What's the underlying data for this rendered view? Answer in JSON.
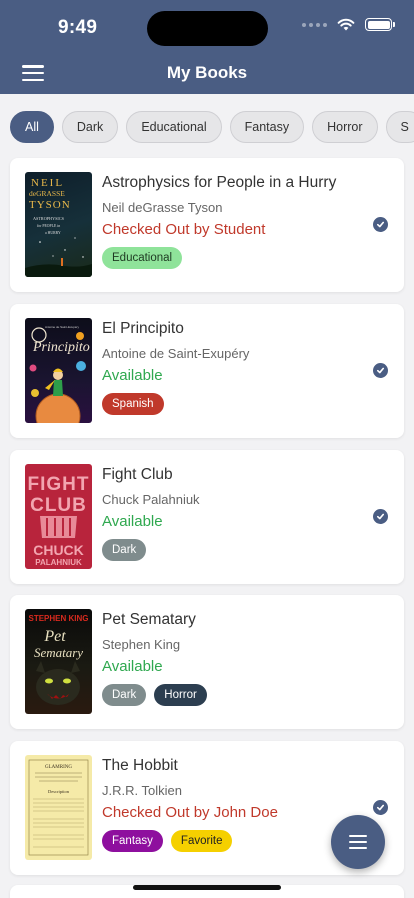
{
  "status_bar": {
    "time": "9:49"
  },
  "header": {
    "title": "My Books"
  },
  "filters": [
    "All",
    "Dark",
    "Educational",
    "Fantasy",
    "Horror",
    "S"
  ],
  "colors": {
    "primary": "#4a5d83",
    "checked_out": "#c0392b",
    "available": "#2fa84f"
  },
  "books": [
    {
      "title": "Astrophysics for People in a Hurry",
      "author": "Neil deGrasse Tyson",
      "status": "Checked Out by Student",
      "cover_lines": [
        "NEIL",
        "deGRASSE",
        "TYSON",
        "ASTROPHYSICS",
        "for PEOPLE in",
        "a HURRY"
      ],
      "tags": [
        {
          "label": "Educational",
          "bg": "#8fe39a",
          "fg": "#1e3a22"
        }
      ]
    },
    {
      "title": "El Principito",
      "author": "Antoine de Saint-Exupéry",
      "status": "Available",
      "cover_lines": [
        "Antoine de Saint-Exupéry",
        "Principito"
      ],
      "tags": [
        {
          "label": "Spanish",
          "bg": "#c0392b",
          "fg": "#ffffff"
        }
      ]
    },
    {
      "title": "Fight Club",
      "author": "Chuck Palahniuk",
      "status": "Available",
      "cover_lines": [
        "FIGHT",
        "CLUB",
        "CHUCK",
        "PALAHNIUK"
      ],
      "tags": [
        {
          "label": "Dark",
          "bg": "#7f8c8d",
          "fg": "#ffffff"
        }
      ]
    },
    {
      "title": "Pet Sematary",
      "author": "Stephen King",
      "status": "Available",
      "cover_lines": [
        "STEPHEN KING",
        "Pet",
        "Sematary"
      ],
      "tags": [
        {
          "label": "Dark",
          "bg": "#7f8c8d",
          "fg": "#ffffff"
        },
        {
          "label": "Horror",
          "bg": "#2c3e50",
          "fg": "#ffffff"
        }
      ]
    },
    {
      "title": "The Hobbit",
      "author": "J.R.R. Tolkien",
      "status": "Checked Out by John Doe",
      "cover_lines": [
        "GLAMRING",
        "Description"
      ],
      "tags": [
        {
          "label": "Fantasy",
          "bg": "#8e0f9e",
          "fg": "#ffffff"
        },
        {
          "label": "Favorite",
          "bg": "#f5d000",
          "fg": "#222222"
        }
      ]
    }
  ]
}
